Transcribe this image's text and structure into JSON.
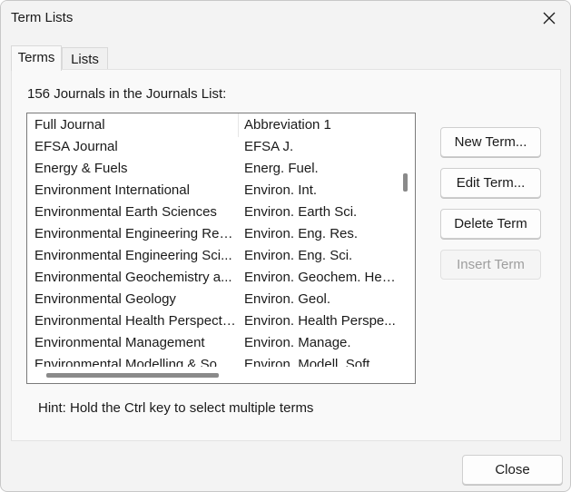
{
  "window": {
    "title": "Term Lists"
  },
  "tabs": [
    {
      "label": "Terms",
      "active": true
    },
    {
      "label": "Lists",
      "active": false
    }
  ],
  "count_label": "156 Journals in the Journals List:",
  "table": {
    "headers": [
      "Full Journal",
      "Abbreviation 1"
    ],
    "rows": [
      [
        "EFSA Journal",
        "EFSA J."
      ],
      [
        "Energy & Fuels",
        "Energ. Fuel."
      ],
      [
        "Environment International",
        "Environ. Int."
      ],
      [
        "Environmental Earth Sciences",
        "Environ. Earth Sci."
      ],
      [
        "Environmental Engineering Res...",
        "Environ. Eng. Res."
      ],
      [
        "Environmental Engineering Sci...",
        "Environ. Eng. Sci."
      ],
      [
        "Environmental Geochemistry a...",
        "Environ. Geochem. Hea..."
      ],
      [
        "Environmental Geology",
        "Environ. Geol."
      ],
      [
        "Environmental Health Perspecti...",
        "Environ. Health Perspe..."
      ],
      [
        "Environmental Management",
        "Environ. Manage."
      ],
      [
        "Environmental Modelling & So...",
        "Environ. Modell. Soft..."
      ]
    ]
  },
  "buttons": {
    "new_term": "New Term...",
    "edit_term": "Edit Term...",
    "delete_term": "Delete Term",
    "insert_term": "Insert Term",
    "close": "Close"
  },
  "hint": "Hint: Hold the Ctrl key to select multiple terms",
  "icons": {
    "close": "close-icon"
  }
}
